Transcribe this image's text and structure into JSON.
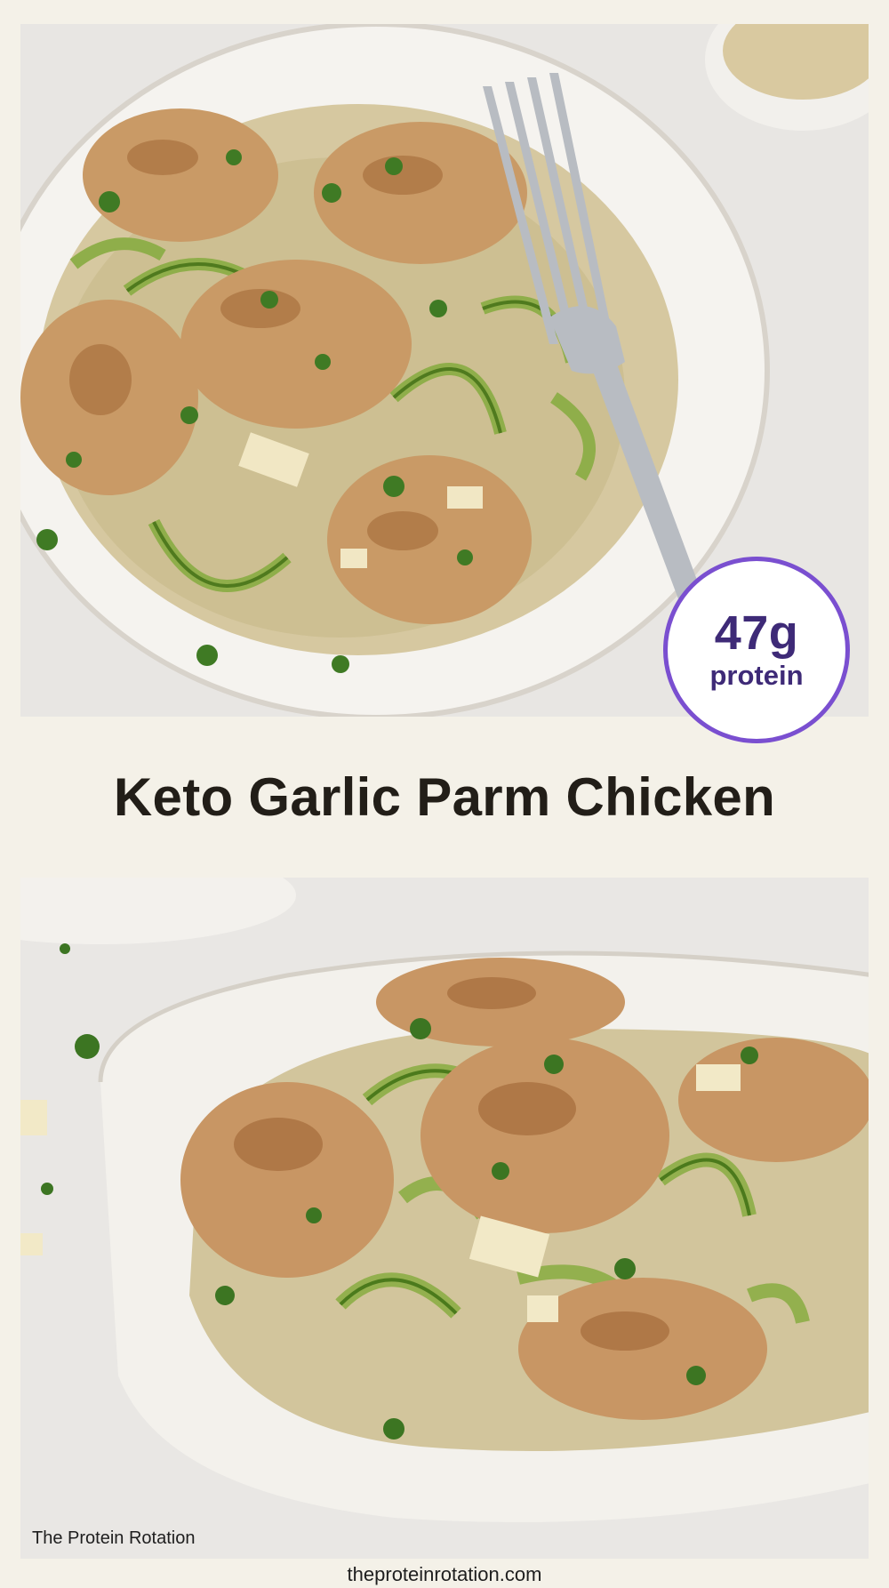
{
  "title": "Keto Garlic Parm Chicken",
  "badge": {
    "value": "47g",
    "label": "protein"
  },
  "brand": "The Protein Rotation",
  "website": "theproteinrotation.com",
  "colors": {
    "background": "#f4f1e8",
    "badge_border": "#7a4fd0",
    "badge_text": "#3e2a77",
    "title_text": "#221e18"
  }
}
